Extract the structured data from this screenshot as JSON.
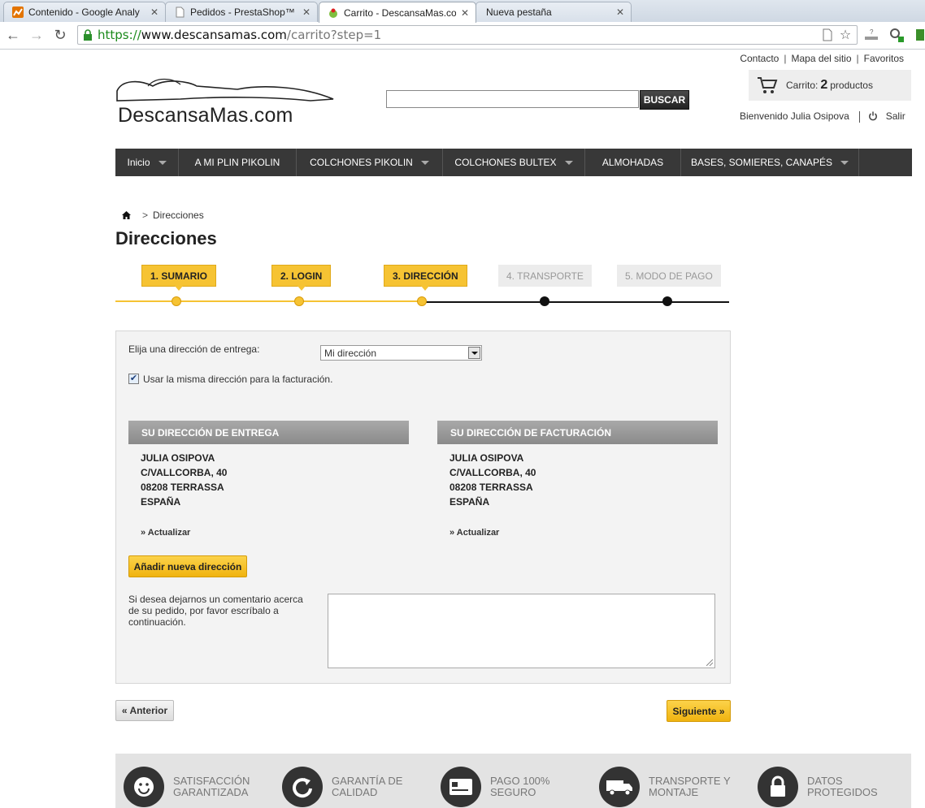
{
  "browser": {
    "tabs": [
      {
        "title": "Contenido - Google Analy",
        "active": false,
        "favicon": "analytics-icon"
      },
      {
        "title": "Pedidos - PrestaShop™",
        "active": false,
        "favicon": "page-icon"
      },
      {
        "title": "Carrito - DescansaMas.co",
        "active": true,
        "favicon": "prestashop-icon"
      },
      {
        "title": "Nueva pestaña",
        "active": false,
        "favicon": ""
      }
    ],
    "url": {
      "scheme": "https://",
      "host": "www.descansamas.com",
      "path": "/carrito?step=1"
    }
  },
  "header": {
    "top_links": [
      "Contacto",
      "Mapa del sitio",
      "Favoritos"
    ],
    "logo_text": "DescansaMas.com",
    "search": {
      "placeholder": "",
      "button": "BUSCAR"
    },
    "cart": {
      "label": "Carrito:",
      "count": "2",
      "unit": "productos"
    },
    "welcome": "Bienvenido Julia Osipova",
    "logout": "Salir"
  },
  "nav": [
    {
      "label": "Inicio",
      "dropdown": true
    },
    {
      "label": "A MI PLIN PIKOLIN",
      "dropdown": false
    },
    {
      "label": "COLCHONES PIKOLIN",
      "dropdown": true
    },
    {
      "label": "COLCHONES BULTEX",
      "dropdown": true
    },
    {
      "label": "ALMOHADAS",
      "dropdown": false
    },
    {
      "label": "BASES, SOMIERES, CANAPÉS",
      "dropdown": true
    }
  ],
  "breadcrumb": {
    "sep": ">",
    "current": "Direcciones"
  },
  "page_title": "Direcciones",
  "steps": [
    {
      "label": "1. SUMARIO",
      "done": true
    },
    {
      "label": "2. LOGIN",
      "done": true
    },
    {
      "label": "3. DIRECCIÓN",
      "done": true
    },
    {
      "label": "4. TRANSPORTE",
      "done": false
    },
    {
      "label": "5. MODO DE PAGO",
      "done": false
    }
  ],
  "form": {
    "choose_label": "Elija una dirección de entrega:",
    "selected_address": "Mi dirección",
    "same_billing_label": "Usar la misma dirección para la facturación.",
    "same_billing_checked": true,
    "delivery": {
      "title": "SU DIRECCIÓN DE ENTREGA",
      "lines": [
        "JULIA OSIPOVA",
        "C/VALLCORBA, 40",
        "08208 TERRASSA",
        "ESPAÑA"
      ],
      "update": "» Actualizar"
    },
    "billing": {
      "title": "SU DIRECCIÓN DE FACTURACIÓN",
      "lines": [
        "JULIA OSIPOVA",
        "C/VALLCORBA, 40",
        "08208 TERRASSA",
        "ESPAÑA"
      ],
      "update": "» Actualizar"
    },
    "add_address": "Añadir nueva dirección",
    "comment_label": "Si desea dejarnos un comentario acerca de su pedido, por favor escríbalo a continuación.",
    "comment_value": ""
  },
  "buttons": {
    "prev": "« Anterior",
    "next": "Siguiente »"
  },
  "features": [
    {
      "icon": "smiley-icon",
      "line1": "SATISFACCIÓN",
      "line2": "GARANTIZADA"
    },
    {
      "icon": "refresh-icon",
      "line1": "GARANTÍA DE",
      "line2": "CALIDAD"
    },
    {
      "icon": "credit-card-icon",
      "line1": "PAGO 100%",
      "line2": "SEGURO"
    },
    {
      "icon": "truck-icon",
      "line1": "TRANSPORTE Y",
      "line2": "MONTAJE"
    },
    {
      "icon": "padlock-icon",
      "line1": "DATOS",
      "line2": "PROTEGIDOS"
    }
  ],
  "colors": {
    "accent": "#f6c333",
    "nav_bg": "#383838",
    "panel_bg": "#f3f3f3",
    "url_green": "#1b8a1b"
  }
}
